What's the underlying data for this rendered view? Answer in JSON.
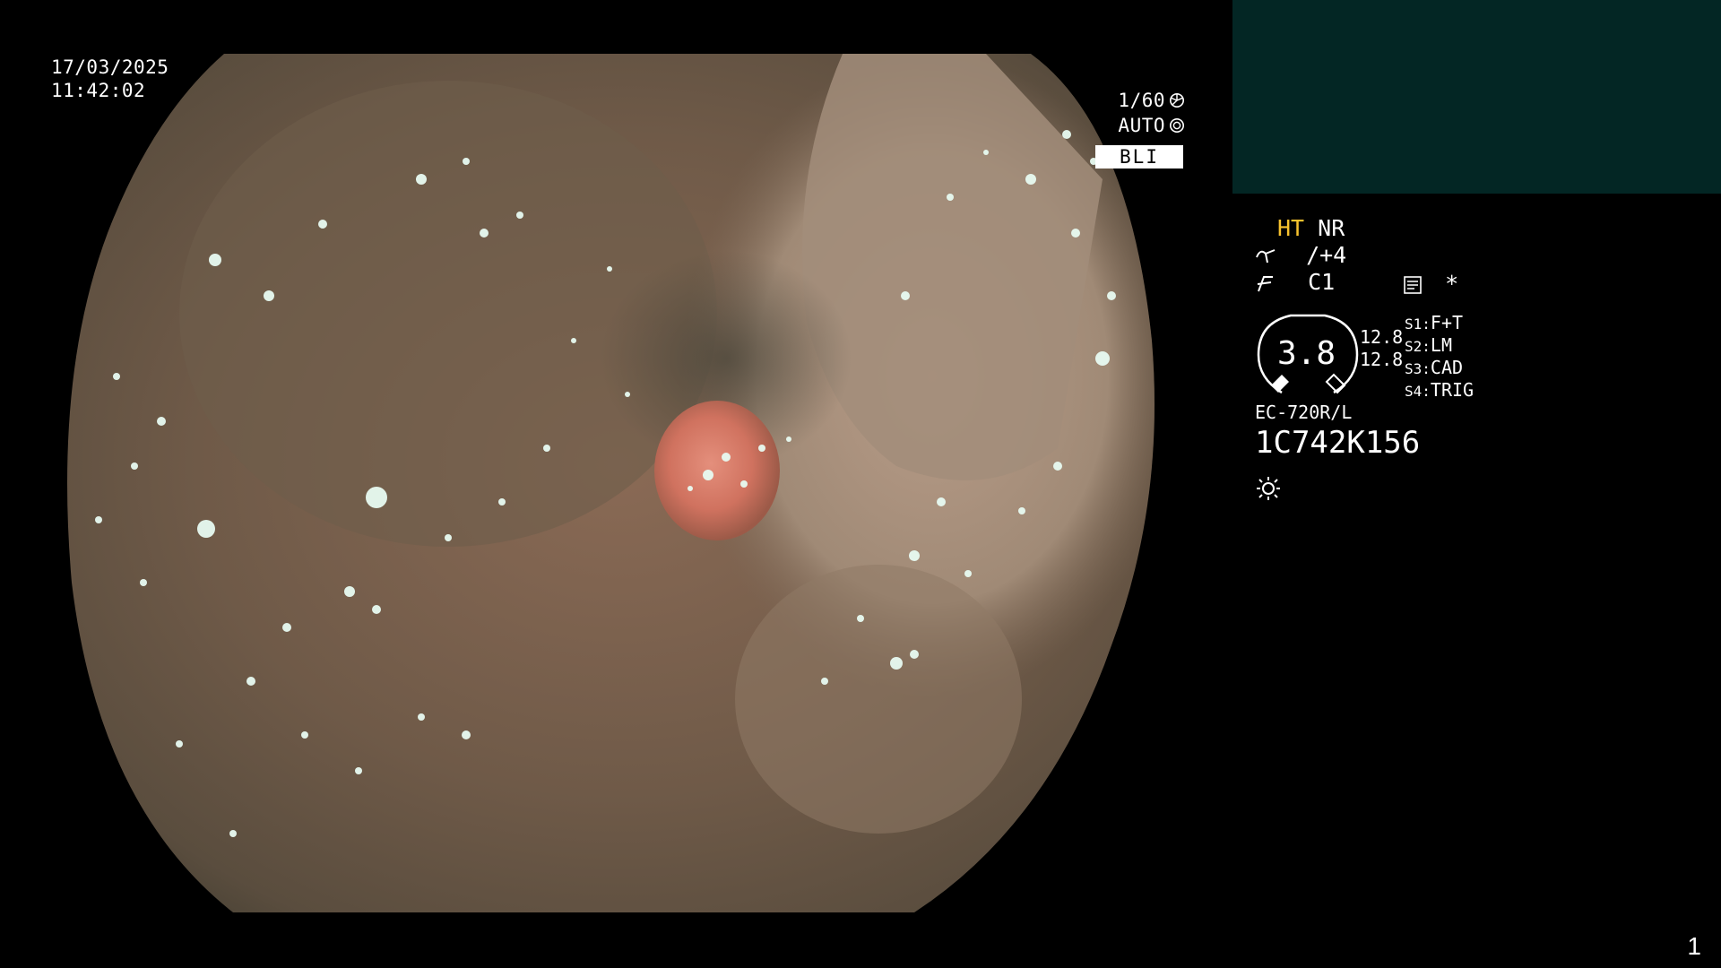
{
  "overlay": {
    "date": "17/03/2025",
    "time": "11:42:02",
    "shutter": "1/60",
    "exposure": "AUTO",
    "mode": "BLI"
  },
  "panel": {
    "ht": "HT",
    "nr": "NR",
    "enhance_value": "/+4",
    "color_value": "C1",
    "asterisk": "*",
    "zoom_value": "3.8",
    "scale_top": "12.8",
    "scale_bottom": "12.8",
    "switches": [
      {
        "key": "S1:",
        "value": "F+T"
      },
      {
        "key": "S2:",
        "value": "LM"
      },
      {
        "key": "S3:",
        "value": "CAD"
      },
      {
        "key": "S4:",
        "value": "TRIG"
      }
    ],
    "scope_model": "EC-720R/L",
    "serial": "1C742K156"
  },
  "frame_counter": "1",
  "colors": {
    "panel_box": "#032624",
    "highlight_yellow": "#f7c22e",
    "tissue_base": "#7a6350"
  },
  "icons": [
    "shutter-icon",
    "iris-icon",
    "enhance-icon",
    "color-mode-icon",
    "memo-icon",
    "light-icon"
  ]
}
